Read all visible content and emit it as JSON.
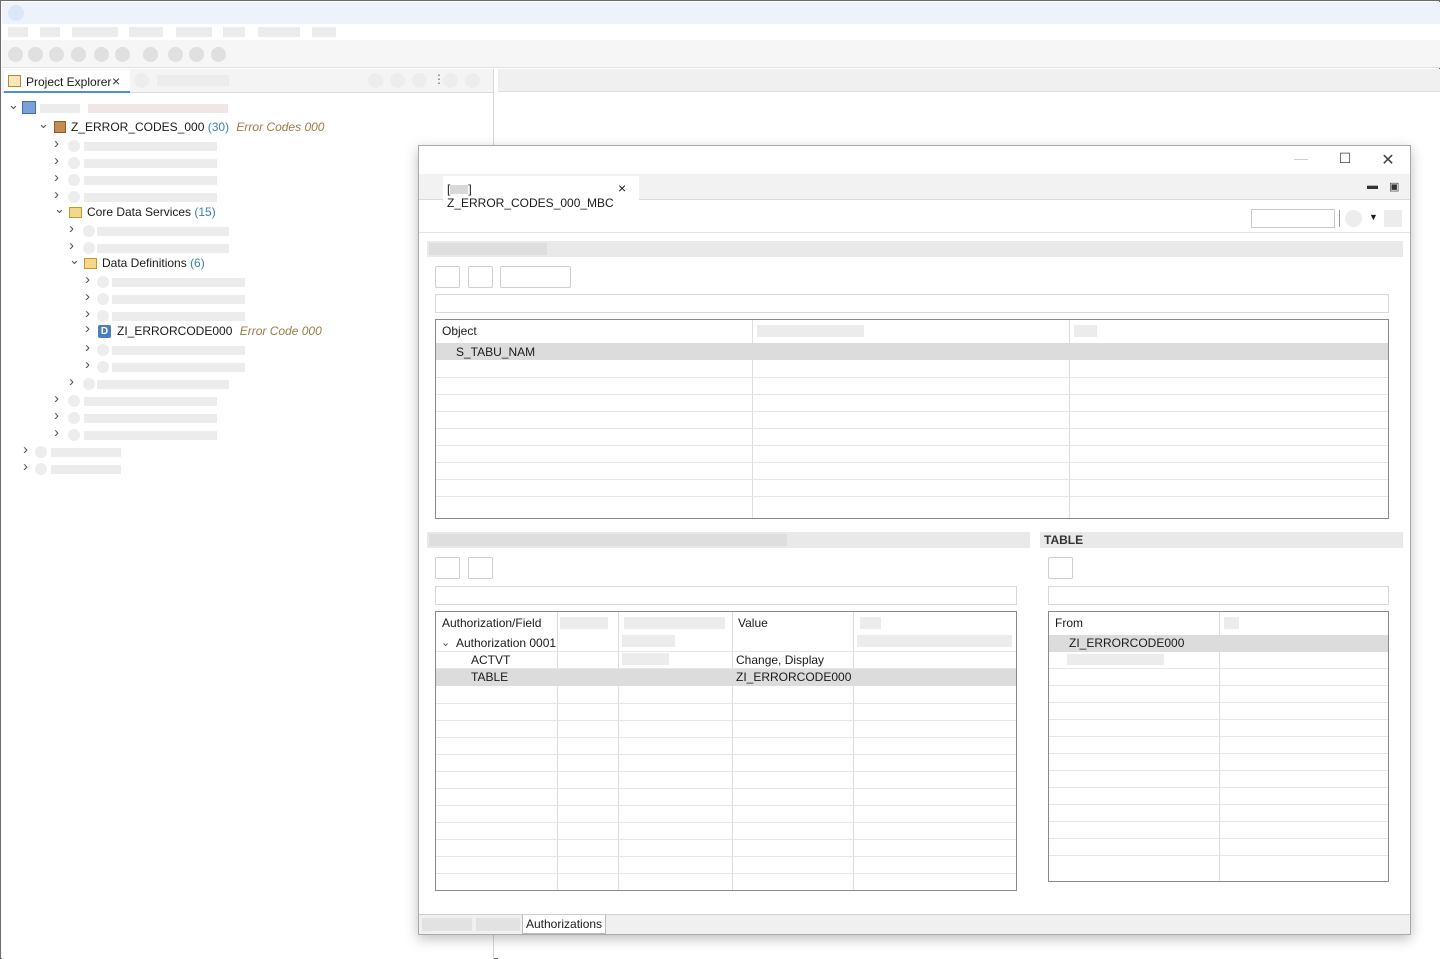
{
  "explorer": {
    "tab_label": "Project Explorer",
    "package": {
      "name": "Z_ERROR_CODES_000",
      "count": "(30)",
      "description": "Error Codes 000"
    },
    "cds_folder": {
      "name": "Core Data Services",
      "count": "(15)"
    },
    "dd_folder": {
      "name": "Data Definitions",
      "count": "(6)"
    },
    "ddl": {
      "name": "ZI_ERRORCODE000",
      "description": "Error Code 000"
    }
  },
  "editor": {
    "tab_label": "Z_ERROR_CODES_000_MBC",
    "tab_prefix": "[",
    "object_table": {
      "headers": [
        "Object"
      ],
      "rows": [
        [
          "S_TABU_NAM"
        ]
      ]
    },
    "auth_table": {
      "headers": [
        "Authorization/Field",
        "Value"
      ],
      "group": "Authorization 0001",
      "rows": [
        {
          "field": "ACTVT",
          "value": "Change, Display"
        },
        {
          "field": "TABLE",
          "value": "ZI_ERRORCODE000"
        }
      ]
    },
    "table_section": {
      "title": "TABLE",
      "headers": [
        "From"
      ],
      "rows": [
        [
          "ZI_ERRORCODE000"
        ]
      ]
    },
    "bottom_tab_active": "Authorizations"
  }
}
